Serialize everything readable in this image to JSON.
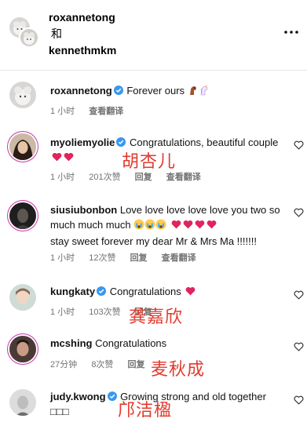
{
  "header": {
    "user1": "roxannetong",
    "and": "和",
    "user2": "kennethmkm"
  },
  "comments": [
    {
      "username": "roxannetong",
      "text": "Forever ours",
      "time": "1 小时",
      "likes": "",
      "reply": "",
      "translate": "查看翻译"
    },
    {
      "username": "myoliemyolie",
      "text": "Congratulations, beautiful couple",
      "time": "1 小时",
      "likes": "201次赞",
      "reply": "回复",
      "translate": "查看翻译",
      "overlay": "胡杏儿"
    },
    {
      "username": "siusiubonbon",
      "text": "Love love love love love you two so much much much",
      "text2": "stay sweet forever my dear Mr & Mrs Ma !!!!!!!",
      "time": "1 小时",
      "likes": "12次赞",
      "reply": "回复",
      "translate": "查看翻译"
    },
    {
      "username": "kungkaty",
      "text": "Congratulations",
      "time": "1 小时",
      "likes": "103次赞",
      "reply": "回复",
      "overlay": "龚嘉欣"
    },
    {
      "username": "mcshing",
      "text": "Congratulations",
      "time": "27分钟",
      "likes": "8次赞",
      "reply": "回复",
      "overlay": "麦秋成"
    },
    {
      "username": "judy.kwong",
      "text": "Growing strong and old together",
      "boxes": "□□□",
      "overlay": "邝洁楹"
    }
  ],
  "colors": {
    "heart": "#e0245e",
    "verified": "#3897f0",
    "overlay": "#e23a2e"
  }
}
